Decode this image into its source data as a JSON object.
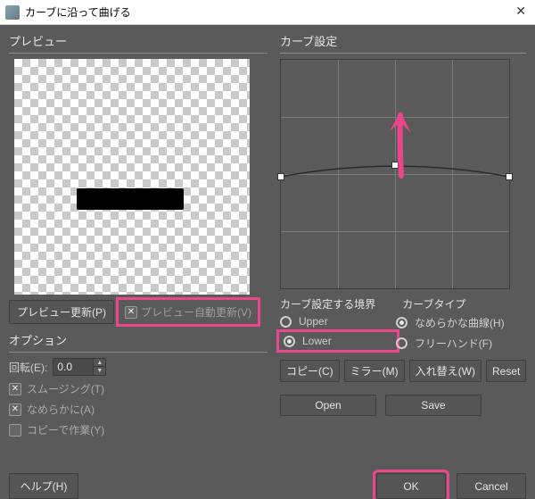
{
  "window": {
    "title": "カーブに沿って曲げる",
    "close_glyph": "✕"
  },
  "left": {
    "preview_label": "プレビュー",
    "update_btn": "プレビュー更新(P)",
    "auto_update_label": "プレビュー自動更新(V)",
    "auto_update_checked": true,
    "options_label": "オプション",
    "rotation_label": "回転(E):",
    "rotation_value": "0.0",
    "smoothing_label": "スムージング(T)",
    "smoothing_checked": true,
    "smooth2_label": "なめらかに(A)",
    "smooth2_checked": true,
    "work_on_copy_label": "コピーで作業(Y)",
    "work_on_copy_checked": false
  },
  "right": {
    "curve_label": "カーブ設定",
    "boundary_label": "カーブ設定する境界",
    "type_label": "カーブタイプ",
    "upper": "Upper",
    "lower": "Lower",
    "smooth_curve": "なめらかな曲線(H)",
    "freehand": "フリーハンド(F)",
    "boundary_selected": "lower",
    "type_selected": "smooth",
    "copy_btn": "コピー(C)",
    "mirror_btn": "ミラー(M)",
    "swap_btn": "入れ替え(W)",
    "reset_btn": "Reset",
    "open_btn": "Open",
    "save_btn": "Save"
  },
  "footer": {
    "help": "ヘルプ(H)",
    "ok": "OK",
    "cancel": "Cancel"
  },
  "chart_data": {
    "type": "line",
    "title": "",
    "xlabel": "",
    "ylabel": "",
    "xlim": [
      0,
      1
    ],
    "ylim": [
      0,
      1
    ],
    "grid": {
      "x": [
        0.25,
        0.5,
        0.75
      ],
      "y": [
        0.25,
        0.5,
        0.75
      ]
    },
    "series": [
      {
        "name": "curve",
        "points": [
          {
            "x": 0.0,
            "y": 0.51
          },
          {
            "x": 0.5,
            "y": 0.46
          },
          {
            "x": 1.0,
            "y": 0.51
          }
        ]
      }
    ],
    "annotations": [
      {
        "type": "arrow",
        "color": "#e9468b",
        "from": {
          "x": 0.52,
          "y": 0.52
        },
        "to": {
          "x": 0.52,
          "y": 0.22
        }
      }
    ]
  }
}
